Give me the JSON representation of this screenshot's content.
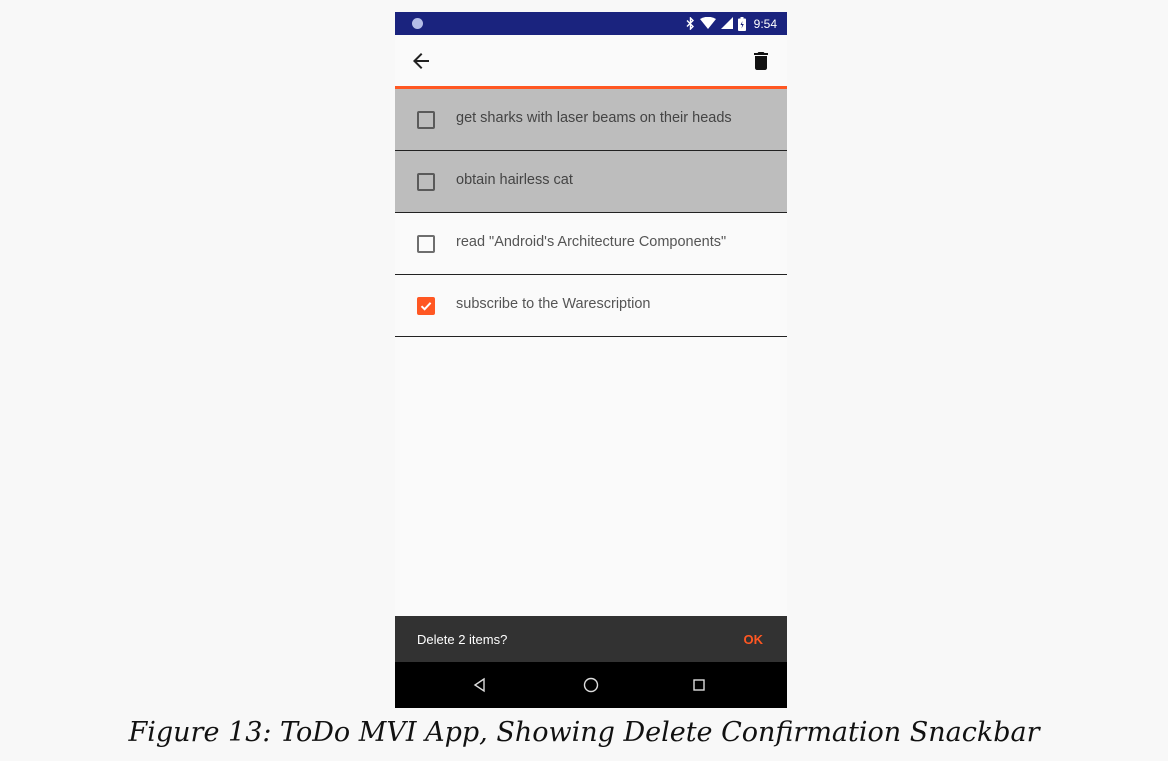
{
  "status_bar": {
    "time": "9:54",
    "icons": [
      "bluetooth-icon",
      "wifi-icon",
      "signal-icon",
      "battery-icon"
    ]
  },
  "toolbar": {
    "back_icon": "arrow-left-icon",
    "delete_icon": "trash-icon"
  },
  "todo_items": [
    {
      "label": "get sharks with laser beams on their heads",
      "checked": false,
      "selected": true
    },
    {
      "label": "obtain hairless cat",
      "checked": false,
      "selected": true
    },
    {
      "label": "read \"Android's Architecture Components\"",
      "checked": false,
      "selected": false
    },
    {
      "label": "subscribe to the Warescription",
      "checked": true,
      "selected": false
    }
  ],
  "snackbar": {
    "message": "Delete 2 items?",
    "action": "OK"
  },
  "nav_bar": {
    "buttons": [
      "back-triangle-icon",
      "home-circle-icon",
      "recents-square-icon"
    ]
  },
  "caption": "Figure 13: ToDo MVI App, Showing Delete Confirmation Snackbar",
  "colors": {
    "accent": "#ff5722",
    "status_bar": "#1a237e",
    "selected_row": "#bdbdbd",
    "snackbar": "#323232"
  }
}
